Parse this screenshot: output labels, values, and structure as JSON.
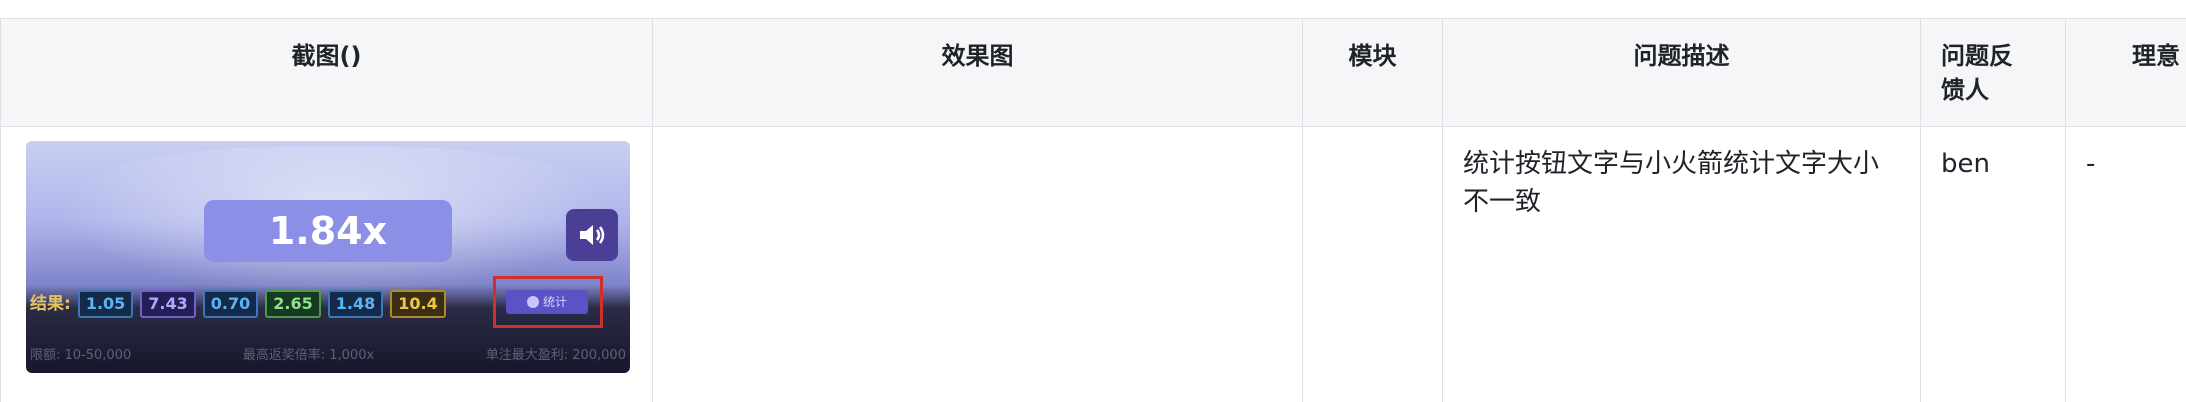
{
  "table": {
    "headers": [
      "截图()",
      "效果图",
      "模块",
      "问题描述",
      "问题反馈人",
      "理意"
    ],
    "rows": [
      {
        "effect": "",
        "module": "",
        "description": "统计按钮文字与小火箭统计文字大小不一致",
        "reporter": "ben",
        "extra": "-"
      }
    ]
  },
  "screenshot": {
    "multiplier": "1.84x",
    "results_label": "结果:",
    "results": [
      {
        "value": "1.05",
        "color": "#5ab4f5"
      },
      {
        "value": "7.43",
        "color": "#9b8cff"
      },
      {
        "value": "0.70",
        "color": "#5ab4f5"
      },
      {
        "value": "2.65",
        "color": "#7ddc7a"
      },
      {
        "value": "1.48",
        "color": "#5ab4f5"
      },
      {
        "value": "10.4",
        "color": "#f0c64a"
      }
    ],
    "stats_button": "统计",
    "limits": [
      "限额: 10-50,000",
      "最高返奖倍率: 1,000x",
      "单注最大盈利: 200,000"
    ],
    "sound_icon": "speaker-icon",
    "highlight_color": "#d0302a"
  }
}
